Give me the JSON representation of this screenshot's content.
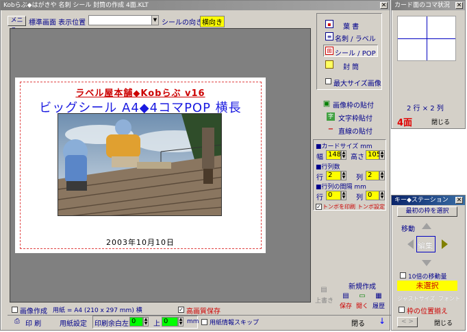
{
  "main": {
    "title": "Kobらぶ◆はがきや 名刺 シール 封筒の作成 4面.KLT",
    "menu_label": "メニュー",
    "display_label": "標準画面 表示位置",
    "display_value": "",
    "orientation_label": "シールの向き",
    "orientation_value": "横向き"
  },
  "preview": {
    "line1": "ラベル屋本舗◆Kobらぶ v16",
    "line2": "ビッグシール A4◆4コマPOP 横長",
    "date": "2003年10月10日"
  },
  "card_types": [
    {
      "label": "葉 書",
      "icon": "postcard-icon"
    },
    {
      "label": "名刺 / ラベル",
      "icon": "business-card-icon"
    },
    {
      "label": "シール / POP",
      "icon": "seal-grid-icon"
    },
    {
      "label": "封 筒",
      "icon": "envelope-icon"
    }
  ],
  "max_size_label": "最大サイズ画像",
  "paste_items": [
    "画像枠の貼付",
    "文字枠貼付",
    "直線の貼付"
  ],
  "card_size": {
    "heading": "■カードサイズ mm",
    "width_label": "幅",
    "width_value": "148",
    "height_label": "高さ",
    "height_value": "105"
  },
  "rows_cols": {
    "heading": "■行列数",
    "row_label": "行",
    "row_value": "2",
    "col_label": "列",
    "col_value": "2"
  },
  "spacing": {
    "heading": "■行列の間隔 mm",
    "row_label": "行",
    "row_value": "0",
    "col_label": "列",
    "col_value": "0"
  },
  "tombo_print": "トンボを印刷",
  "tombo_settings": "トンボ設定",
  "new_create": "新規作成",
  "overwrite": "上書き",
  "save": "保存",
  "open": "開く",
  "history": "履歴",
  "image_create_label": "画像作成",
  "paper_info": "用紙 = A4 (210 x 297 mm) 横",
  "hq_save_label": "高画質保存",
  "print_label": "印 刷",
  "paper_settings": "用紙設定",
  "margin_label": "印刷余白左",
  "margin_left": "0",
  "margin_top_label": "上",
  "margin_top": "0",
  "mm_unit": "mm",
  "skip_paper_info": "用紙情報スキップ",
  "close_main": "閉る",
  "card_window": {
    "title": "カード面のコマ状況",
    "grid_label": "2 行 × 2 列",
    "face_count": "4面",
    "close": "閉じる"
  },
  "key_station": {
    "title": "キー◆ステーション",
    "select_first": "最初の枠を選択",
    "move_label": "移動",
    "edit_label": "編集",
    "tenfold_label": "10倍の移動量",
    "status": "未選択",
    "just_size": "ジャストサイズ",
    "font": "フォント",
    "align_label": "枠の位置揃え",
    "prev_next": "< >",
    "close": "閉じる"
  },
  "colors": {
    "title_red": "#cc0000",
    "title_blue": "#1a1ae0",
    "face_red": "#e00000",
    "highlight_yellow": "#ffff00"
  }
}
